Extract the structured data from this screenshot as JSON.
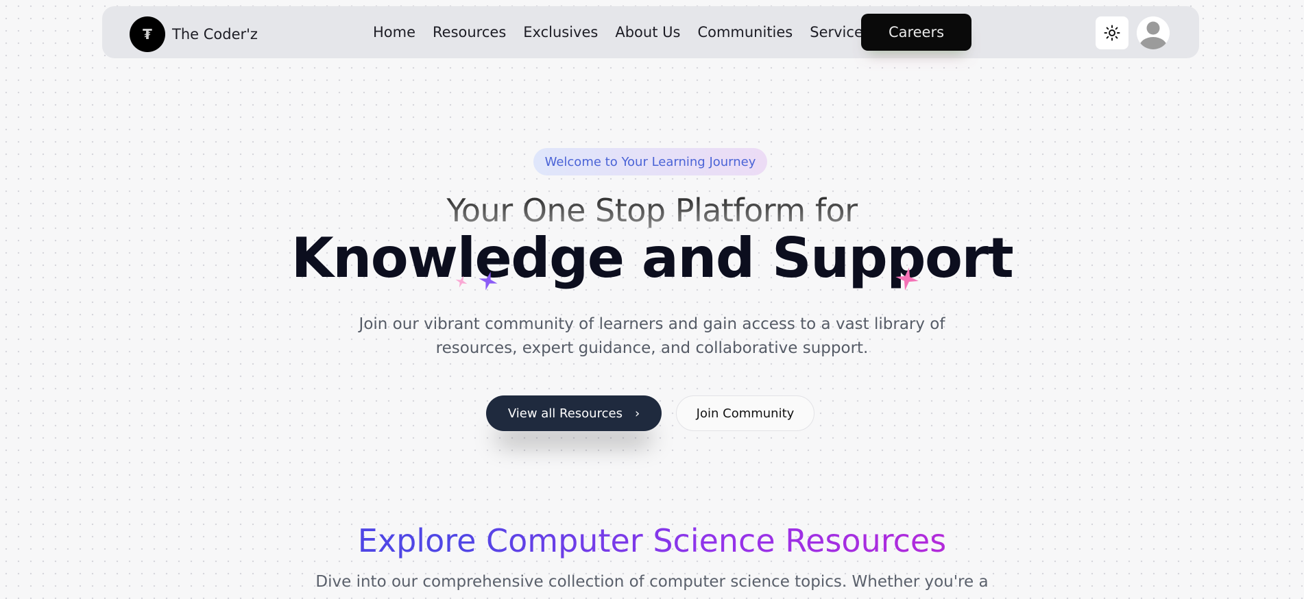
{
  "brand": {
    "logo_glyph": "₮",
    "name": "The Coder'z"
  },
  "nav": {
    "links": [
      "Home",
      "Resources",
      "Exclusives",
      "About Us",
      "Communities",
      "Services"
    ],
    "careers_label": "Careers",
    "theme_icon": "sun-icon",
    "avatar_icon": "user-avatar-icon"
  },
  "hero": {
    "badge": "Welcome to Your Learning Journey",
    "subtitle": "Your One Stop Platform for",
    "title": "Knowledge and Support",
    "description_line1": "Join our vibrant community of learners and gain access to a vast library of",
    "description_line2": "resources, expert guidance, and collaborative support.",
    "primary_button": "View all Resources",
    "primary_button_arrow": "›",
    "secondary_button": "Join Community"
  },
  "section": {
    "title": "Explore Computer Science Resources",
    "description": "Dive into our comprehensive collection of computer science topics. Whether you're a"
  },
  "colors": {
    "accent_dark": "#1f2a3e",
    "badge_text": "#4a63d6",
    "gradient_start": "#4f46e5",
    "gradient_end": "#c026d3",
    "sparkle_pink": "#f472b6",
    "sparkle_purple": "#8b5cf6"
  }
}
